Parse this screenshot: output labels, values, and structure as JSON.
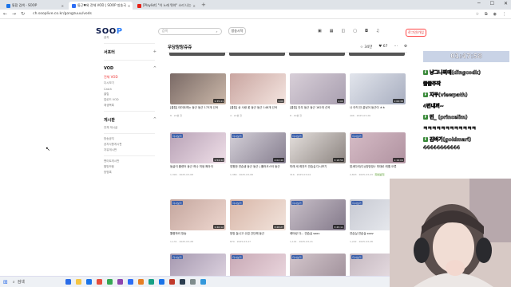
{
  "browser": {
    "tabs": [
      {
        "label": "통합 검색 - SOOP",
        "color": "#1a73e8",
        "active": false
      },
      {
        "label": "둥근♥와 전체 VOD | SOOP 방송국",
        "color": "#2d6ef5",
        "active": true
      },
      {
        "label": "[Playlist] \"이 노래 뭐야\" 소리 나는",
        "color": "#e62117",
        "active": false
      }
    ],
    "url": "ch.sooplive.co.kr/gongzuuu/vods",
    "new_tab": "+"
  },
  "header": {
    "logo_main": "SOO",
    "logo_accent": "P",
    "search_placeholder": "검색",
    "golive_label": "방송시작",
    "login_label": "로그인/가입"
  },
  "sidebar": {
    "top_label": "공지",
    "sections": [
      {
        "title": "서포터",
        "items": []
      },
      {
        "title": "VOD",
        "items": [
          {
            "label": "전체 VOD",
            "selected": true
          },
          {
            "label": "다시보기"
          },
          {
            "label": "Catch"
          },
          {
            "label": "클립"
          },
          {
            "label": "업로드 VOD"
          },
          {
            "label": "재생목록"
          }
        ]
      },
      {
        "title": "게시판",
        "items": [
          {
            "label": "전체 게시글",
            "selected": false
          }
        ]
      }
    ],
    "extra_items": [
      "방송공지",
      "공지사항게시판",
      "자유게시판",
      "팬아트게시판",
      "짤방모음",
      "방명록"
    ]
  },
  "main": {
    "category": "우당탕탕쥬쥬",
    "bookmark_count": "34만",
    "follow_count": "67",
    "rows": [
      [
        {
          "title": "[클립] 데이트하는 둥근 둥근 173개 선곡",
          "meta": "8 · 22분 전",
          "dur": "1:35:41",
          "badge": "",
          "colors": [
            "#7a6a66",
            "#cbb8a9"
          ]
        },
        {
          "title": "[클립] 상 사랑 꽃 둥근 둥근 148개 선곡",
          "meta": "4 · 22분 전",
          "dur": "1:00",
          "badge": "",
          "colors": [
            "#c9a5a0",
            "#f4e5e0"
          ]
        },
        {
          "title": "[클립] 안무 둥근 둥근 162개 선곡",
          "meta": "8 · 40분 전",
          "dur": "1:00",
          "badge": "",
          "colors": [
            "#d8cfd8",
            "#a99fb0"
          ]
        },
        {
          "title": "나 아직 안 끝났어 둥근이 ㅎㅎ",
          "meta": "496 · 2025-03-26",
          "dur": "1:00:38",
          "badge": "",
          "colors": [
            "#e2e5ec",
            "#a8aec0"
          ]
        }
      ],
      [
        {
          "title": "둥글이 흘렸어 둥근 하나 미생 짜아이",
          "meta": "1,390 · 2025-03-08",
          "dur": "1:54:42",
          "badge": "다시보기",
          "colors": [
            "#b8a2b6",
            "#efdfe8"
          ]
        },
        {
          "title": "영원한 연습생 둥근 둥근 | 롤러코스터 둥근",
          "meta": "1,380 · 2025-03-08",
          "dur": "4:02:40",
          "badge": "다시보기",
          "colors": [
            "#d4d0d8",
            "#877f90"
          ]
        },
        {
          "title": "미래 세 레전드 연습실 다시보기",
          "meta": "316 · 2025-03-04",
          "dur": "3:18:50",
          "badge": "다시보기",
          "colors": [
            "#e5e0dd",
            "#8c8480"
          ]
        },
        {
          "title": "밤새다리(다)(방방방)! 미대로 레벨 오류",
          "meta": "2,823 · 2025-03-23",
          "dur": "1:19:04",
          "badge": "다시보기",
          "colors": [
            "#d6bcc6",
            "#b092a0"
          ],
          "tag": "다시보기"
        }
      ],
      [
        {
          "title": "월병하러 방송",
          "meta": "1,131 · 2025-03-28",
          "dur": "1:40:12",
          "badge": "다시보기",
          "colors": [
            "#c4a69e",
            "#efd8d0"
          ]
        },
        {
          "title": "방방 놀니고 수업 간단해 둥근",
          "meta": "870 · 2025-03-27",
          "dur": "3:28:27",
          "badge": "다시보기",
          "colors": [
            "#d8b6a8",
            "#f2e4dc"
          ]
        },
        {
          "title": "레터링 다... 연습실 soov",
          "meta": "1,101 · 2025-03-21",
          "dur": "3:45:11",
          "badge": "다시보기",
          "colors": [
            "#c9c0c9",
            "#83798a"
          ]
        },
        {
          "title": "연습실 연습실 soov",
          "meta": "1,222 · 2025-03-28",
          "dur": "1:56:06",
          "badge": "다시보기",
          "colors": [
            "#c7c9d2",
            "#eceef2"
          ]
        }
      ],
      [
        {
          "title": "",
          "meta": "",
          "dur": "",
          "badge": "다시보기",
          "colors": [
            "#a699b0",
            "#e0d6e2"
          ]
        },
        {
          "title": "",
          "meta": "",
          "dur": "",
          "badge": "다시보기",
          "colors": [
            "#c8a9b5",
            "#ecd9e0"
          ]
        },
        {
          "title": "",
          "meta": "",
          "dur": "",
          "badge": "다시보기",
          "colors": [
            "#d4c6cc",
            "#9d8e98"
          ]
        },
        {
          "title": "",
          "meta": "",
          "dur": "",
          "badge": "다시보기",
          "colors": [
            "#c5b8c0",
            "#efe6ea"
          ]
        }
      ]
    ]
  },
  "overlay": {
    "clock": "01:47:58",
    "chat": [
      "냥그나찌데(dingcodk)",
      "줍줍주작",
      "지쿠(viewpath)",
      "4번내꺼~",
      "민_ (princelim)",
      "ㅋㅋㅋㅋㅋㅋㅋㅋㅋㅋㅋㅋ",
      "김바기(goldmari)",
      "44444444444"
    ]
  },
  "taskbar": {
    "search_label": "검색",
    "icons": [
      "#2b6de8",
      "#f5c542",
      "#1a73e8",
      "#e74c3c",
      "#34a853",
      "#8e44ad",
      "#2d6ef5",
      "#e67e22",
      "#16a085",
      "#1a73e8",
      "#c0392b",
      "#2c3e50",
      "#7f8c8d",
      "#3498db"
    ]
  }
}
